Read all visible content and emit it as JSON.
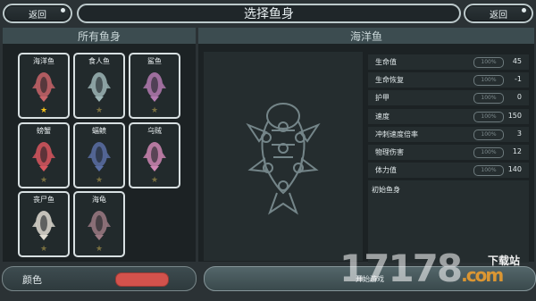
{
  "header": {
    "back_left": "返回",
    "title": "选择鱼身",
    "back_right": "返回"
  },
  "left_panel": {
    "heading": "所有鱼身",
    "fish": [
      {
        "name": "海洋鱼",
        "star": "★",
        "starred": true,
        "color": "#c9646a"
      },
      {
        "name": "食人鱼",
        "star": "★",
        "starred": false,
        "color": "#9db6b7"
      },
      {
        "name": "鲨鱼",
        "star": "★",
        "starred": false,
        "color": "#b47ab2"
      },
      {
        "name": "螃蟹",
        "star": "★",
        "starred": false,
        "color": "#d9565f"
      },
      {
        "name": "蝠鲼",
        "star": "★",
        "starred": false,
        "color": "#5a6fa6"
      },
      {
        "name": "乌贼",
        "star": "★",
        "starred": false,
        "color": "#cf86b4"
      },
      {
        "name": "丧尸鱼",
        "star": "★",
        "starred": false,
        "color": "#e0dcd2"
      },
      {
        "name": "海龟",
        "star": "★",
        "starred": false,
        "color": "#9c7a84"
      }
    ]
  },
  "right_panel": {
    "heading": "海洋鱼",
    "stats": [
      {
        "label": "生命值",
        "pct": "100%",
        "value": "45"
      },
      {
        "label": "生命恢复",
        "pct": "100%",
        "value": "-1"
      },
      {
        "label": "护甲",
        "pct": "100%",
        "value": "0"
      },
      {
        "label": "速度",
        "pct": "100%",
        "value": "150"
      },
      {
        "label": "冲刺速度倍率",
        "pct": "100%",
        "value": "3"
      },
      {
        "label": "物理伤害",
        "pct": "100%",
        "value": "12"
      },
      {
        "label": "体力值",
        "pct": "100%",
        "value": "140"
      }
    ],
    "description": "初始鱼身"
  },
  "bottom": {
    "color_label": "颜色",
    "swatch_color": "#d3524c",
    "start_label": "开始游戏"
  },
  "watermark": {
    "digits": "17178",
    "suffix": ".com",
    "tag": "下载站"
  }
}
